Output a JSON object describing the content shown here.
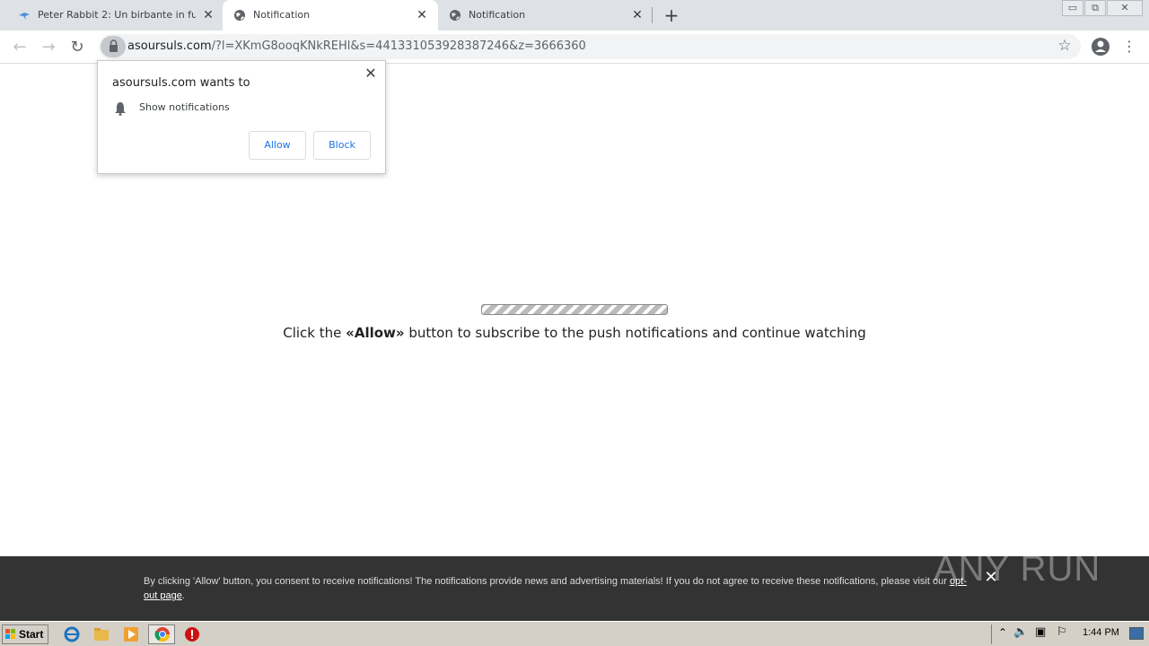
{
  "browser": {
    "tabs": [
      {
        "title": "Peter Rabbit 2: Un birbante in fuga (",
        "icon": "bird-icon",
        "active": false
      },
      {
        "title": "Notification",
        "icon": "globe-icon",
        "active": true
      },
      {
        "title": "Notification",
        "icon": "globe-icon",
        "active": false
      }
    ],
    "url_host": "asoursuls.com",
    "url_rest": "/?l=XKmG8ooqKNkREHl&s=441331053928387246&z=3666360"
  },
  "permission_popup": {
    "title": "asoursuls.com wants to",
    "permission_label": "Show notifications",
    "allow_label": "Allow",
    "block_label": "Block"
  },
  "page": {
    "cta_prefix": "Click the ",
    "cta_bold": "«Allow»",
    "cta_suffix": " button to subscribe to the push notifications and continue watching"
  },
  "consent_bar": {
    "text": "By clicking 'Allow' button, you consent to receive notifications! The notifications provide news and advertising materials! If you do not agree to receive these notifications, please visit our ",
    "link_text": "opt-out page",
    "text_end": "."
  },
  "watermark": "ANY RUN",
  "taskbar": {
    "start_label": "Start",
    "clock": "1:44 PM"
  }
}
